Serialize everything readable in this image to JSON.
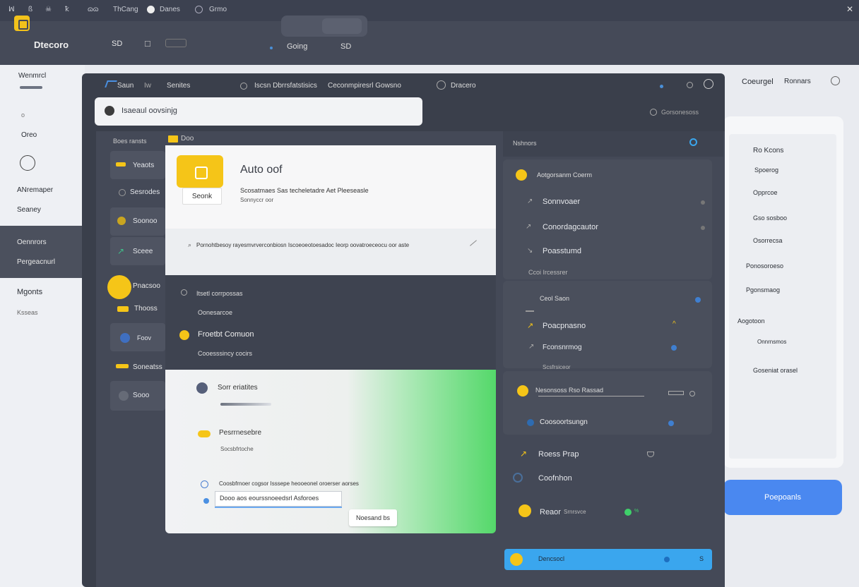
{
  "topbar": {
    "items": [
      "ꟽ",
      "ß",
      "☠",
      "ꝁ",
      "ɷɷ",
      "ThCang",
      "Danes",
      "Grmo"
    ]
  },
  "header": {
    "app_name": "Dtecoro",
    "nav": [
      "SD",
      "☐"
    ],
    "search_label": "Going",
    "search_value": "SD"
  },
  "bg_sidebar": {
    "title": "Wenmrcl",
    "items": [
      "o",
      "Oreo",
      "ANremaper",
      "Seaney",
      "Oennrors",
      "Pergeacnurl",
      "Mgonts",
      "Ksseas"
    ]
  },
  "window": {
    "tabs": [
      "Saun",
      "Iw",
      "Senites",
      "Iscsn Dbrrsfatstisics",
      "Ceconmpiresrl Gowsno",
      "Dracero"
    ],
    "notice_text": "Isaeaul oovsinjg",
    "side_label": "Gorsonesoss",
    "list_header": "Boes ransts",
    "list_items": [
      "Yeaots",
      "Sesrodes",
      "Soonoo",
      "Sceee",
      "Pnacsoo",
      "Thooss",
      "Foov",
      "Soneatss",
      "Sooo"
    ],
    "folder_label": "Doo"
  },
  "card": {
    "title": "Auto oof",
    "description": "Scosatmaes Sas techeletadre Aet Pleeseasle",
    "sub": "Sonnyccr oor",
    "search_button": "Seonk",
    "path_text": "Pornohtbesoy rayesmvrverconbiosn Iscoeoeotoesadoc Ieorp oovatroeceocu oor aste",
    "dark_items": [
      "Itsetl corrpossas",
      "Oonesarcoe",
      "Froetbt Comuon",
      "Cooesssincy cocirs"
    ],
    "bottom_items": [
      "Sorr eriatites",
      "Pesrrnesebre",
      "Socsbfrtoche"
    ],
    "bottom_note": "Coosbfrnoer cogsor Isssepe heooeonel oroerser aorses",
    "field_value": "Dooo aos eourssnoeedsrl Asforoes",
    "small_button": "Noesand bs"
  },
  "right_panel": {
    "header": "Nshnors",
    "group1_title": "Aotgorsanm Coerm",
    "group1": [
      "Sonnvoaer",
      "Conordagcautor",
      "Poasstumd",
      "Ccoi Ircessrer"
    ],
    "group2_title": "Ceol Saon",
    "group2": [
      "Poacpnasno",
      "Fconsnrmog",
      "Scsfrsiceor"
    ],
    "group3_title": "Nesonsoss Rso Rassad",
    "group3": [
      "Coosoortsungn"
    ],
    "items": [
      "Roess Prap",
      "Coofnhon",
      "Reaor"
    ],
    "status": "Srnrsvce",
    "blue_bar": "Dencsocl",
    "blue_bar_num": "S"
  },
  "bg_right": {
    "title": "Coeurgel",
    "tab": "Ronnars",
    "items": [
      "Ro Kcons",
      "Spoerog",
      "Opprcoe",
      "Gso sosboo",
      "Osorrecsa",
      "Ponosoroeso",
      "Pgonsmaog",
      "Aogotoon",
      "Onnrnsmos",
      "Goseniat orasel"
    ],
    "cta": "Poepoanls"
  },
  "colors": {
    "accent_yellow": "#f5c518",
    "accent_blue": "#3aa6ee",
    "accent_green": "#54d86a",
    "window_dark": "#3a3f4b"
  }
}
